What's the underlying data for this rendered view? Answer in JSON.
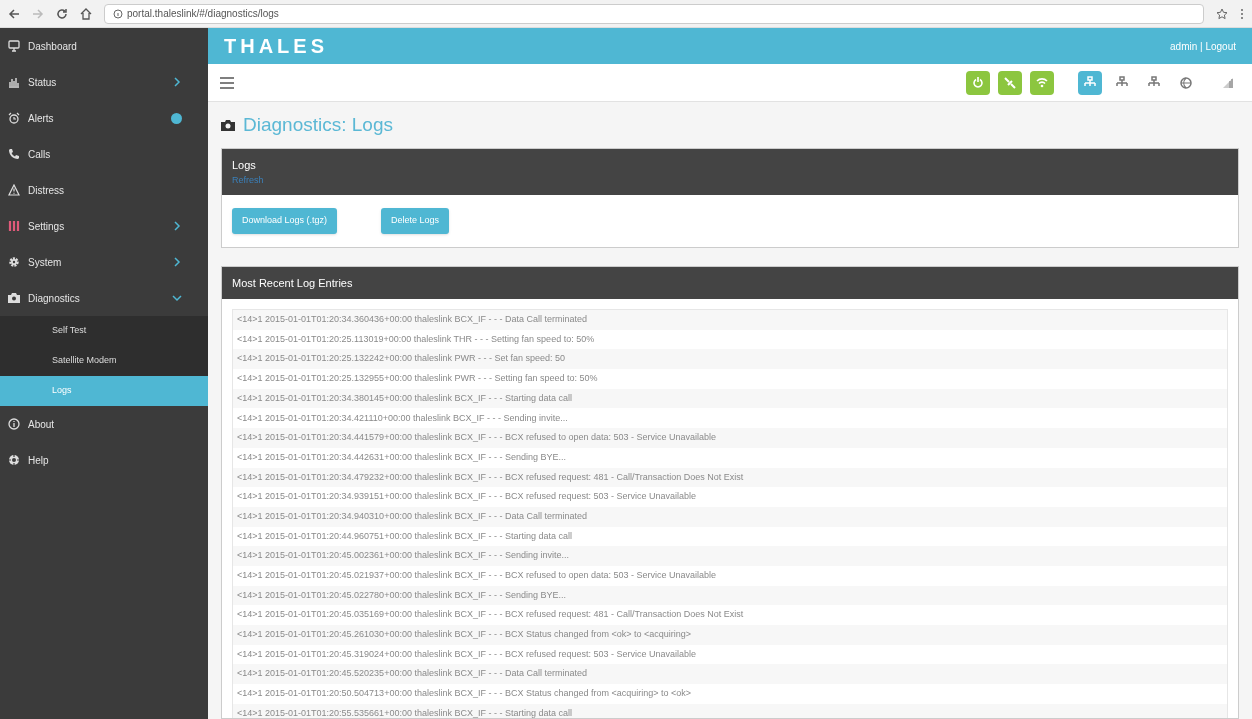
{
  "browser": {
    "url": "portal.thaleslink/#/diagnostics/logs"
  },
  "sidebar": {
    "items": [
      {
        "label": "Dashboard",
        "kind": "monitor",
        "selected": false
      },
      {
        "label": "Status",
        "kind": "chart",
        "selected": false,
        "expanded": false
      },
      {
        "label": "Alerts",
        "kind": "alarm",
        "selected": false,
        "badge": true
      },
      {
        "label": "Calls",
        "kind": "phone",
        "selected": false
      },
      {
        "label": "Distress",
        "kind": "warning",
        "selected": false
      },
      {
        "label": "Settings",
        "kind": "sliders",
        "selected": false,
        "expanded": false
      },
      {
        "label": "System",
        "kind": "gear",
        "selected": false,
        "expanded": false
      },
      {
        "label": "Diagnostics",
        "kind": "camera",
        "selected": false,
        "expanded": true,
        "children": [
          {
            "label": "Self Test",
            "selected": false
          },
          {
            "label": "Satellite Modem",
            "selected": false
          },
          {
            "label": "Logs",
            "selected": true
          }
        ]
      },
      {
        "label": "About",
        "kind": "info",
        "selected": false
      },
      {
        "label": "Help",
        "kind": "lifebuoy",
        "selected": false
      }
    ]
  },
  "header": {
    "logo": "THALES",
    "user_links": "admin | Logout"
  },
  "toolbar": {
    "status_icons": [
      {
        "kind": "power",
        "on": true
      },
      {
        "kind": "satellite",
        "on": true
      },
      {
        "kind": "wifi",
        "on": true
      },
      {
        "kind": "network",
        "selected": true
      },
      {
        "kind": "network",
        "selected": false
      },
      {
        "kind": "network",
        "selected": false
      },
      {
        "kind": "globe",
        "selected": false
      },
      {
        "kind": "signal",
        "selected": false
      }
    ]
  },
  "page_title": "Diagnostics: Logs",
  "logs_panel": {
    "title": "Logs",
    "link": "Refresh",
    "buttons": [
      "Download Logs (.tgz)",
      "Delete Logs"
    ]
  },
  "recent_panel": {
    "title": "Most Recent Log Entries",
    "entries": [
      "<14>1 2015-01-01T01:20:34.360436+00:00 thaleslink BCX_IF - - - Data Call terminated",
      "<14>1 2015-01-01T01:20:25.113019+00:00 thaleslink THR - - - Setting fan speed to: 50%",
      "<14>1 2015-01-01T01:20:25.132242+00:00 thaleslink PWR - - - Set fan speed: 50",
      "<14>1 2015-01-01T01:20:25.132955+00:00 thaleslink PWR - - - Setting fan speed to: 50%",
      "<14>1 2015-01-01T01:20:34.380145+00:00 thaleslink BCX_IF - - - Starting data call",
      "<14>1 2015-01-01T01:20:34.421110+00:00 thaleslink BCX_IF - - - Sending invite...",
      "<14>1 2015-01-01T01:20:34.441579+00:00 thaleslink BCX_IF - - - BCX refused to open data: 503 - Service Unavailable",
      "<14>1 2015-01-01T01:20:34.442631+00:00 thaleslink BCX_IF - - - Sending BYE...",
      "<14>1 2015-01-01T01:20:34.479232+00:00 thaleslink BCX_IF - - - BCX refused request: 481 - Call/Transaction Does Not Exist",
      "<14>1 2015-01-01T01:20:34.939151+00:00 thaleslink BCX_IF - - - BCX refused request: 503 - Service Unavailable",
      "<14>1 2015-01-01T01:20:34.940310+00:00 thaleslink BCX_IF - - - Data Call terminated",
      "<14>1 2015-01-01T01:20:44.960751+00:00 thaleslink BCX_IF - - - Starting data call",
      "<14>1 2015-01-01T01:20:45.002361+00:00 thaleslink BCX_IF - - - Sending invite...",
      "<14>1 2015-01-01T01:20:45.021937+00:00 thaleslink BCX_IF - - - BCX refused to open data: 503 - Service Unavailable",
      "<14>1 2015-01-01T01:20:45.022780+00:00 thaleslink BCX_IF - - - Sending BYE...",
      "<14>1 2015-01-01T01:20:45.035169+00:00 thaleslink BCX_IF - - - BCX refused request: 481 - Call/Transaction Does Not Exist",
      "<14>1 2015-01-01T01:20:45.261030+00:00 thaleslink BCX_IF - - - BCX Status changed from <ok> to <acquiring>",
      "<14>1 2015-01-01T01:20:45.319024+00:00 thaleslink BCX_IF - - - BCX refused request: 503 - Service Unavailable",
      "<14>1 2015-01-01T01:20:45.520235+00:00 thaleslink BCX_IF - - - Data Call terminated",
      "<14>1 2015-01-01T01:20:50.504713+00:00 thaleslink BCX_IF - - - BCX Status changed from <acquiring> to <ok>",
      "<14>1 2015-01-01T01:20:55.535661+00:00 thaleslink BCX_IF - - - Starting data call"
    ]
  }
}
